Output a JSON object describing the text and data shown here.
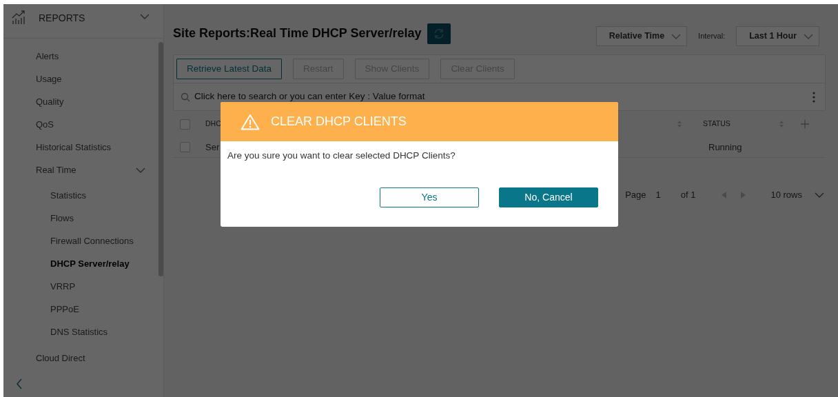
{
  "sidebar": {
    "header": "REPORTS",
    "expanded": true,
    "items": [
      {
        "label": "Alerts",
        "selected": false
      },
      {
        "label": "Usage",
        "selected": false
      },
      {
        "label": "Quality",
        "selected": false
      },
      {
        "label": "QoS",
        "selected": false
      },
      {
        "label": "Historical Statistics",
        "selected": false
      },
      {
        "label": "Real Time",
        "selected": false,
        "expanded": true,
        "children": [
          {
            "label": "Statistics",
            "selected": false
          },
          {
            "label": "Flows",
            "selected": false
          },
          {
            "label": "Firewall Connections",
            "selected": false
          },
          {
            "label": "DHCP Server/relay",
            "selected": true
          },
          {
            "label": "VRRP",
            "selected": false
          },
          {
            "label": "PPPoE",
            "selected": false
          },
          {
            "label": "DNS Statistics",
            "selected": false
          }
        ]
      },
      {
        "label": "Cloud Direct",
        "selected": false
      }
    ]
  },
  "main": {
    "title": "Site Reports:Real Time DHCP Server/relay",
    "time_mode": "Relative Time",
    "interval": {
      "label": "Interval:",
      "value": "Last 1 Hour"
    },
    "toolbar": [
      {
        "label": "Retrieve Latest Data",
        "disabled": false
      },
      {
        "label": "Restart",
        "disabled": true
      },
      {
        "label": "Show Clients",
        "disabled": true
      },
      {
        "label": "Clear Clients",
        "disabled": true
      }
    ],
    "search": {
      "placeholder": "Click here to search or you can enter Key : Value format"
    },
    "table": {
      "header_checked": false,
      "columns": [
        "DHC",
        "STATUS"
      ],
      "rows": [
        {
          "checked": false,
          "cells": [
            "Ser",
            "Running"
          ]
        }
      ]
    },
    "pagination": {
      "label": "Page",
      "page": "1",
      "total": "of 1",
      "rows": "10 rows"
    }
  },
  "dialog": {
    "title": "CLEAR DHCP CLIENTS",
    "message": "Are you sure you want to clear selected DHCP Clients?",
    "buttons": [
      {
        "label": "Yes",
        "kind": "secondary"
      },
      {
        "label": "No, Cancel",
        "kind": "primary"
      }
    ]
  }
}
